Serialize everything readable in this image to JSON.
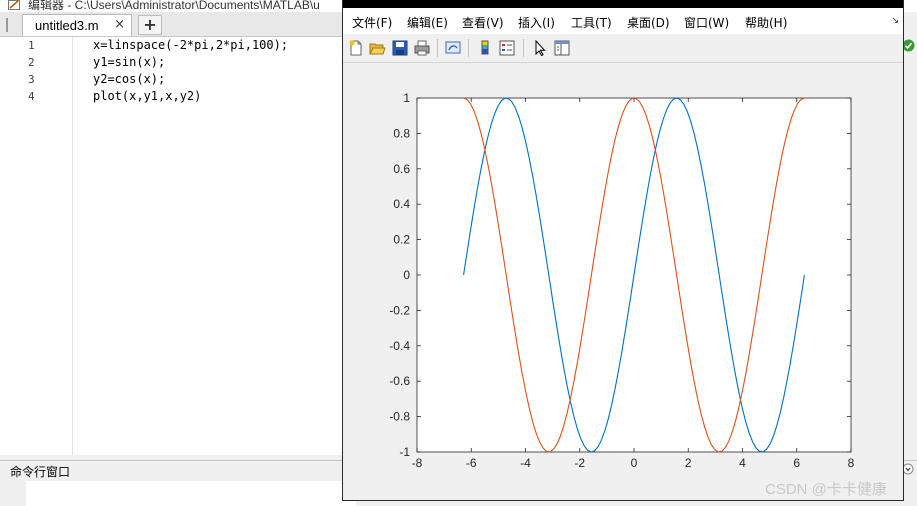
{
  "editor": {
    "title": "编辑器 - C:\\Users\\Administrator\\Documents\\MATLAB\\u",
    "tab_label": "untitled3.m",
    "tab_close": "×",
    "tab_add": "+",
    "code_lines": [
      {
        "num": "1",
        "text": "x=linspace(-2*pi,2*pi,100);"
      },
      {
        "num": "2",
        "text": "y1=sin(x);"
      },
      {
        "num": "3",
        "text": "y2=cos(x);"
      },
      {
        "num": "4",
        "text": "plot(x,y1,x,y2)"
      }
    ]
  },
  "command_window": {
    "label": "命令行窗口"
  },
  "figure": {
    "menu": [
      "文件(F)",
      "编辑(E)",
      "查看(V)",
      "插入(I)",
      "工具(T)",
      "桌面(D)",
      "窗口(W)",
      "帮助(H)"
    ],
    "menu_arrow": "↘",
    "toolbar_icons": [
      "new-figure-icon",
      "open-file-icon",
      "save-icon",
      "print-icon",
      "link-plot-icon",
      "colorbar-icon",
      "legend-icon",
      "pointer-icon",
      "property-editor-icon"
    ]
  },
  "chart_data": {
    "type": "line",
    "title": "",
    "xlabel": "",
    "ylabel": "",
    "xlim": [
      -8,
      8
    ],
    "ylim": [
      -1,
      1
    ],
    "xticks": [
      -8,
      -6,
      -4,
      -2,
      0,
      2,
      4,
      6,
      8
    ],
    "yticks": [
      1,
      0.8,
      0.6,
      0.4,
      0.2,
      0,
      -0.2,
      -0.4,
      -0.6,
      -0.8,
      -1
    ],
    "x_start": -6.283,
    "x_end": 6.283,
    "n_points": 100,
    "grid": false,
    "series": [
      {
        "color": "#0072BD",
        "function": "sin(x)"
      },
      {
        "color": "#D95319",
        "function": "cos(x)"
      }
    ]
  },
  "watermark": "CSDN @卡卡健康"
}
